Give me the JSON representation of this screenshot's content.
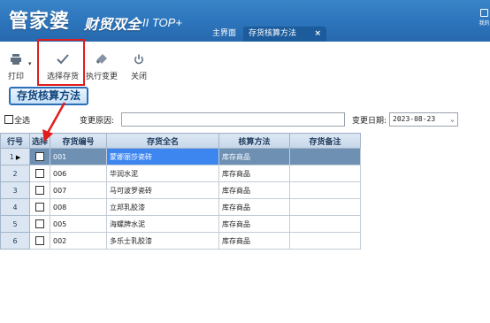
{
  "app": {
    "brand_main": "管家婆",
    "brand_sub": "财贸双全",
    "brand_version": "II TOP+",
    "corner_label": "我的"
  },
  "tabs": [
    {
      "label": "主界面"
    },
    {
      "label": "存货核算方法",
      "close": "×"
    }
  ],
  "toolbar": {
    "print_label": "打印",
    "select_label": "选择存货",
    "exec_label": "执行变更",
    "close_label": "关闭"
  },
  "page_title": "存货核算方法",
  "filter": {
    "all_label": "全选",
    "reason_label": "变更原因:",
    "reason_value": "",
    "date_label": "变更日期:",
    "date_value": "2023-08-23"
  },
  "table": {
    "columns": [
      "行号",
      "选择",
      "存货编号",
      "存货全名",
      "核算方法",
      "存货备注"
    ],
    "rows": [
      {
        "no": "1",
        "code": "001",
        "name": "蒙娜丽莎瓷砖",
        "method": "库存商品",
        "remark": ""
      },
      {
        "no": "2",
        "code": "006",
        "name": "华润水泥",
        "method": "库存商品",
        "remark": ""
      },
      {
        "no": "3",
        "code": "007",
        "name": "马可波罗瓷砖",
        "method": "库存商品",
        "remark": ""
      },
      {
        "no": "4",
        "code": "008",
        "name": "立邦乳胶漆",
        "method": "库存商品",
        "remark": ""
      },
      {
        "no": "5",
        "code": "005",
        "name": "海螺牌水泥",
        "method": "库存商品",
        "remark": ""
      },
      {
        "no": "6",
        "code": "002",
        "name": "多乐士乳胶漆",
        "method": "库存商品",
        "remark": ""
      }
    ]
  },
  "colors": {
    "header_blue": "#2c74bb",
    "highlight_red": "#e21c1c",
    "selected_row": "#6d90b3"
  }
}
